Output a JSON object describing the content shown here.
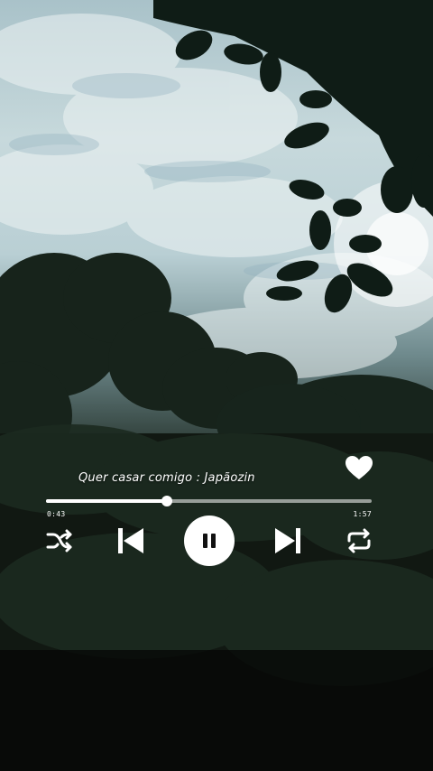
{
  "song": {
    "title": "Quer casar comigo : Japãozin"
  },
  "progress": {
    "fraction": 0.37,
    "elapsed": "0:43",
    "total": "1:57"
  },
  "controls": {
    "shuffle_icon": "shuffle-icon",
    "previous_icon": "skip-previous-icon",
    "play_pause_icon": "pause-icon",
    "next_icon": "skip-next-icon",
    "repeat_icon": "repeat-icon",
    "like_icon": "heart-icon"
  },
  "colors": {
    "foreground": "#ffffff",
    "sky": "#c7d9dc",
    "foliage": "#151d18"
  }
}
